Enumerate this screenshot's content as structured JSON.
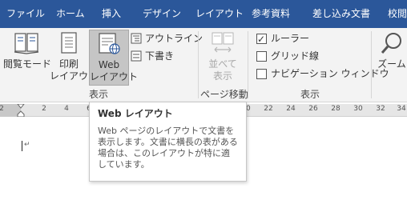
{
  "tabs": [
    {
      "label": "ファイル"
    },
    {
      "label": "ホーム"
    },
    {
      "label": "挿入"
    },
    {
      "label": "デザイン"
    },
    {
      "label": "レイアウト"
    },
    {
      "label": "参考資料"
    },
    {
      "label": "差し込み文書"
    },
    {
      "label": "校閲"
    }
  ],
  "ribbon": {
    "view_group": {
      "read_mode": "閲覧モード",
      "print_layout_line1": "印刷",
      "print_layout_line2": "レイアウト",
      "web_layout_line1": "Web",
      "web_layout_line2": "レイアウト",
      "outline": "アウトライン",
      "draft": "下書き",
      "label": "表示"
    },
    "page_move_group": {
      "side_by_side_line1": "並べて",
      "side_by_side_line2": "表示",
      "label": "ページ移動"
    },
    "show_group": {
      "ruler": "ルーラー",
      "ruler_checked": true,
      "gridlines": "グリッド線",
      "gridlines_checked": false,
      "nav_pane": "ナビゲーション ウィンドウ",
      "nav_pane_checked": false,
      "label": "表示"
    },
    "zoom": "ズーム"
  },
  "ruler": {
    "numbers": [
      "2",
      "2",
      "4",
      "6",
      "20",
      "22",
      "24",
      "26",
      "28",
      "30",
      "32",
      "34"
    ]
  },
  "tooltip": {
    "title": "Web レイアウト",
    "body": "Web ページのレイアウトで文書を表示します。文書に横長の表がある場合は、このレイアウトが特に適しています。"
  },
  "colors": {
    "accent": "#2b579a",
    "ribbon_bg": "#f3f3f3"
  }
}
